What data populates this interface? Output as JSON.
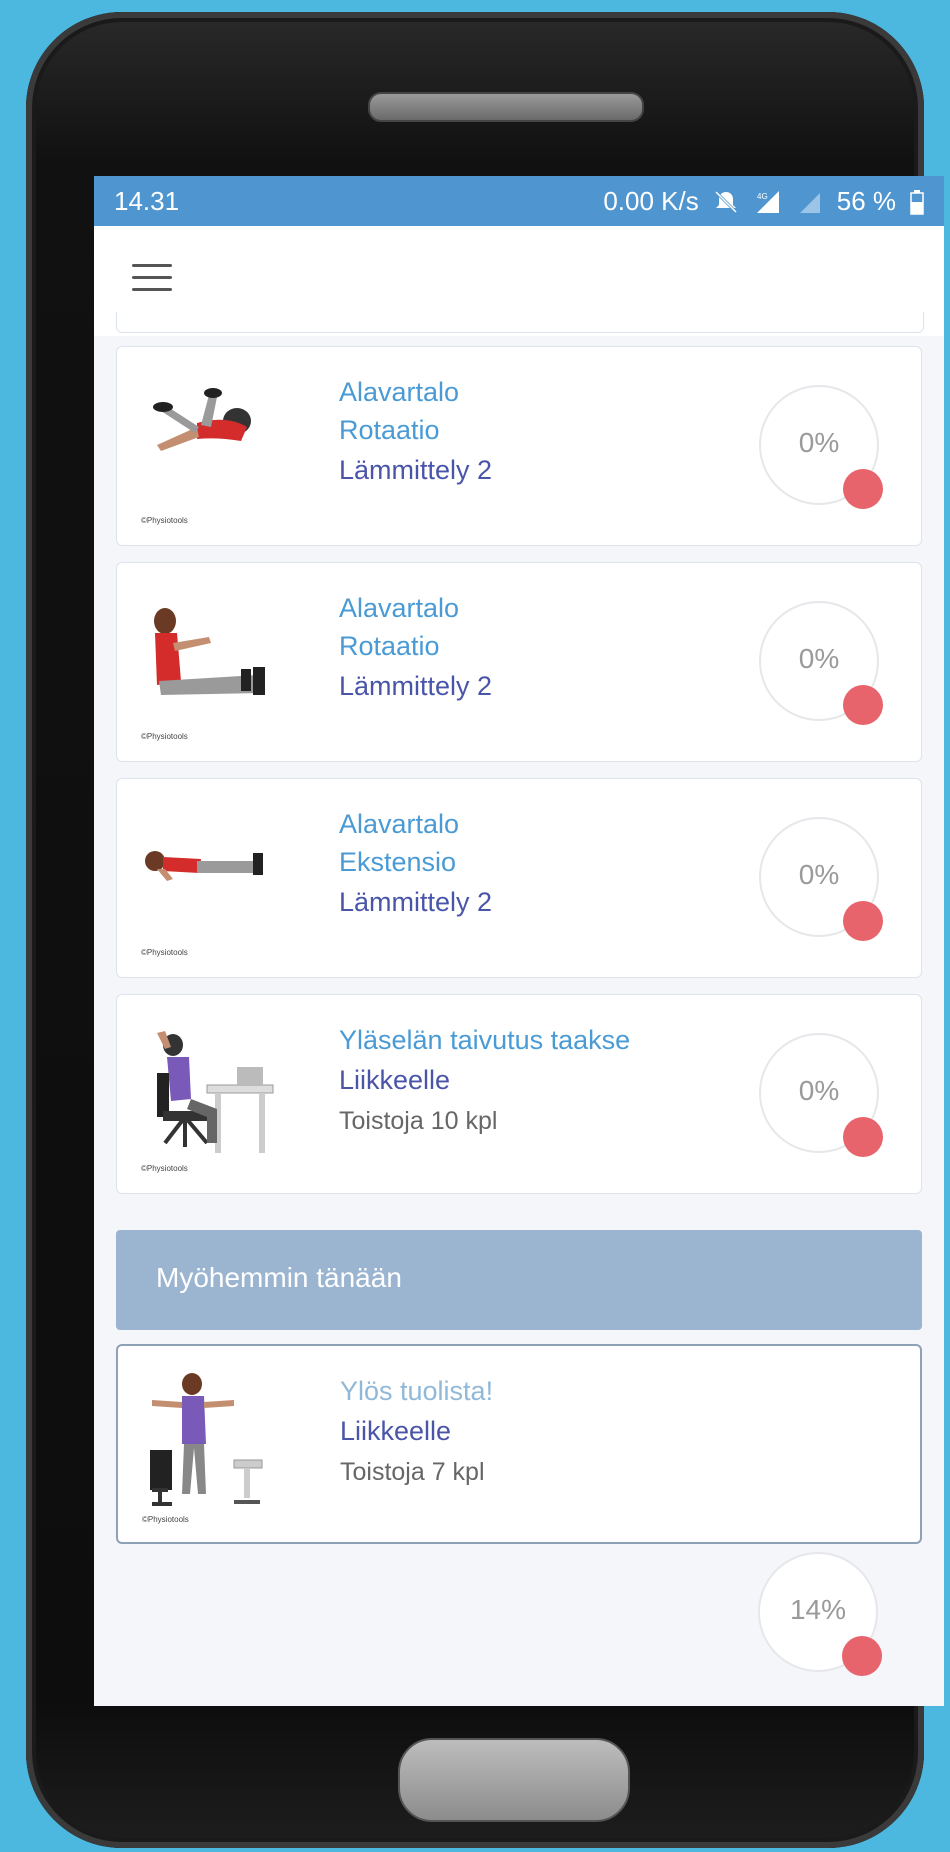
{
  "statusbar": {
    "time": "14.31",
    "network_speed": "0.00 K/s",
    "battery": "56 %"
  },
  "appbar": {
    "menu_icon": "hamburger-menu-icon"
  },
  "exercises": [
    {
      "line1": "Alavartalo",
      "line2": "Rotaatio",
      "category": "Lämmittely 2",
      "progress": "0%",
      "copyright": "©Physiotools",
      "figure": "lying-rotation"
    },
    {
      "line1": "Alavartalo",
      "line2": "Rotaatio",
      "category": "Lämmittely 2",
      "progress": "0%",
      "copyright": "©Physiotools",
      "figure": "seated-rotation"
    },
    {
      "line1": "Alavartalo",
      "line2": "Ekstensio",
      "category": "Lämmittely 2",
      "progress": "0%",
      "copyright": "©Physiotools",
      "figure": "prone-extension"
    },
    {
      "line1": "Yläselän taivutus taakse",
      "category": "Liikkeelle",
      "reps": "Toistoja 10 kpl",
      "progress": "0%",
      "copyright": "©Physiotools",
      "figure": "desk-back-bend"
    }
  ],
  "later_section": {
    "title": "Myöhemmin tänään"
  },
  "upcoming": {
    "line1": "Ylös tuolista!",
    "category": "Liikkeelle",
    "reps": "Toistoja 7 kpl",
    "copyright": "©Physiotools",
    "figure": "stand-up-from-chair"
  },
  "overall_progress": "14%",
  "colors": {
    "statusbar": "#4f95cf",
    "title_blue": "#4a9bd5",
    "category_indigo": "#4a55a8",
    "section_header": "#9bb4d0",
    "progress_dot": "#e8646c",
    "background": "#4cb8e0"
  }
}
